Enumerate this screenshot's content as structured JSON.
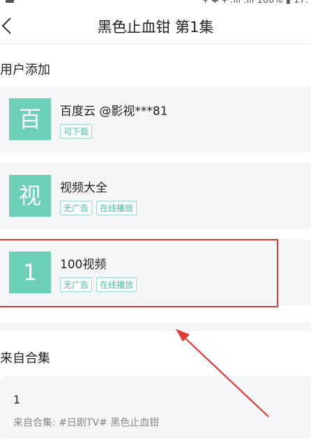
{
  "status_bar": {
    "right_text": "¥ ✱ ¥ .ıll .ıll 100% ▮ 17:"
  },
  "header": {
    "title": "黑色止血钳 第1集"
  },
  "user_added": {
    "section_title": "用户添加",
    "sources": [
      {
        "badge": "百",
        "name": "百度云 @影视***81",
        "tags": [
          "可下载"
        ]
      },
      {
        "badge": "视",
        "name": "视频大全",
        "tags": [
          "无广告",
          "在线播放"
        ]
      },
      {
        "badge": "1",
        "name": "100视频",
        "tags": [
          "无广告",
          "在线播放"
        ]
      }
    ]
  },
  "collection": {
    "section_title": "来自合集",
    "item": {
      "episode": "1",
      "subtitle": "来自合集: #日剧TV# 黑色止血钳"
    }
  },
  "colors": {
    "badge": "#6ccfb8",
    "tag_text": "#4bbf9f",
    "highlight": "#e53935"
  },
  "icons": {
    "back": "chevron-left-icon"
  }
}
